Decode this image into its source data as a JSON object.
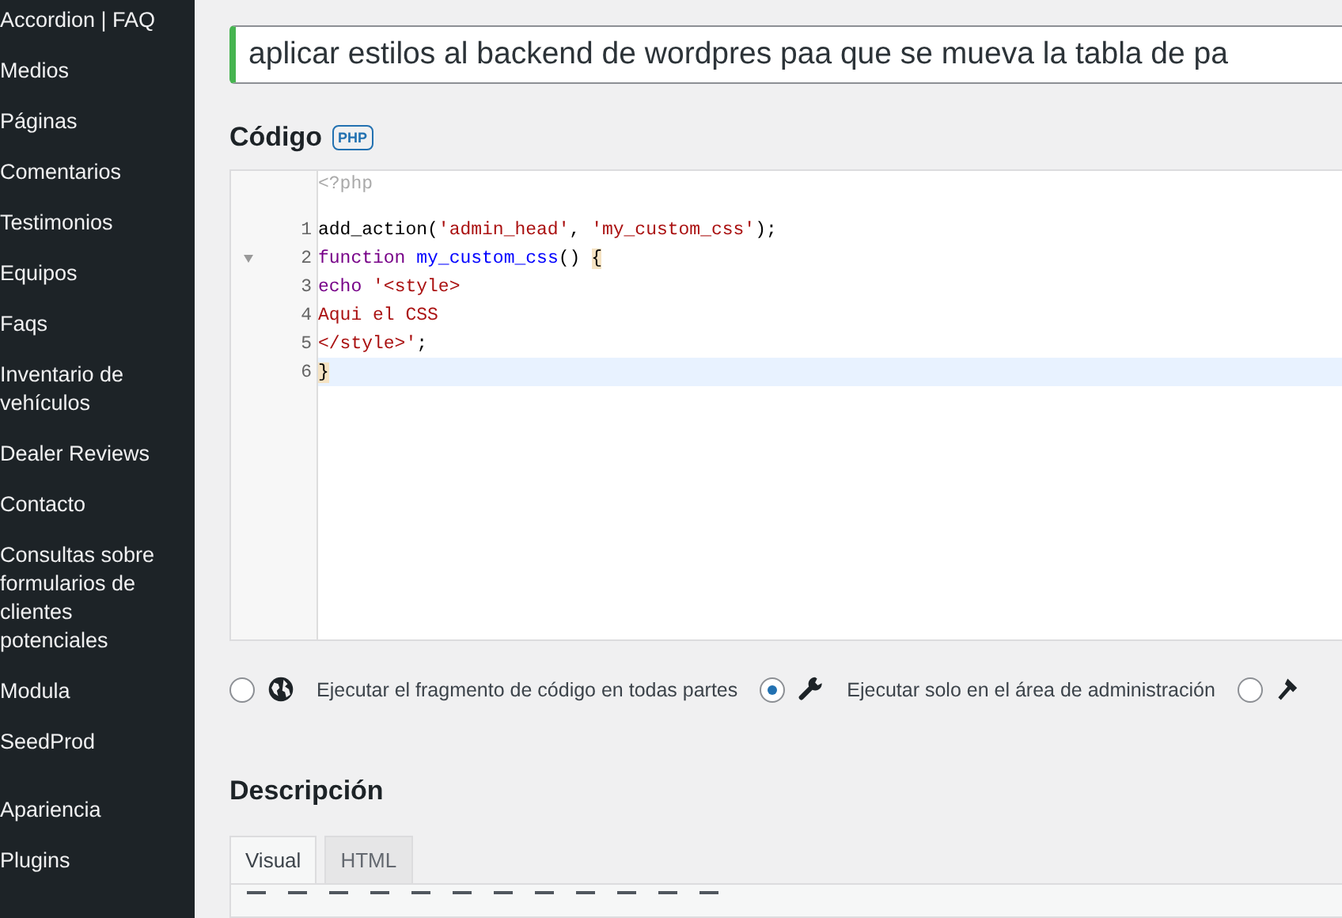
{
  "sidebar": {
    "groups": [
      {
        "items": [
          "Accordion | FAQ",
          "Medios",
          "Páginas",
          "Comentarios",
          "Testimonios",
          "Equipos",
          "Faqs",
          "Inventario de vehículos",
          "Dealer Reviews",
          "Contacto",
          "Consultas sobre formularios de clientes potenciales",
          "Modula",
          "SeedProd"
        ]
      },
      {
        "items": [
          "Apariencia",
          "Plugins"
        ]
      }
    ]
  },
  "title_field": {
    "value": "aplicar estilos al backend de wordpres paa que se mueva la tabla de pa"
  },
  "code_section": {
    "heading": "Código",
    "badge": "PHP",
    "opening_tag": "<?php",
    "lines": [
      {
        "number": "1",
        "fold": false,
        "active": false,
        "tokens": [
          {
            "kind": "plain",
            "text": "add_action("
          },
          {
            "kind": "string",
            "text": "'admin_head'"
          },
          {
            "kind": "plain",
            "text": ", "
          },
          {
            "kind": "string",
            "text": "'my_custom_css'"
          },
          {
            "kind": "plain",
            "text": ");"
          }
        ]
      },
      {
        "number": "2",
        "fold": true,
        "active": false,
        "tokens": [
          {
            "kind": "keyword",
            "text": "function "
          },
          {
            "kind": "def",
            "text": "my_custom_css"
          },
          {
            "kind": "plain",
            "text": "() "
          },
          {
            "kind": "bracket",
            "text": "{"
          }
        ]
      },
      {
        "number": "3",
        "fold": false,
        "active": false,
        "tokens": [
          {
            "kind": "keyword",
            "text": "echo "
          },
          {
            "kind": "string",
            "text": "'<style>"
          }
        ]
      },
      {
        "number": "4",
        "fold": false,
        "active": false,
        "tokens": [
          {
            "kind": "string",
            "text": "Aqui el CSS"
          }
        ]
      },
      {
        "number": "5",
        "fold": false,
        "active": false,
        "tokens": [
          {
            "kind": "string",
            "text": "</style>'"
          },
          {
            "kind": "plain",
            "text": ";"
          }
        ]
      },
      {
        "number": "6",
        "fold": false,
        "active": true,
        "tokens": [
          {
            "kind": "bracket",
            "text": "}"
          }
        ]
      }
    ]
  },
  "scope_options": [
    {
      "label": "Ejecutar el fragmento de código en todas partes",
      "selected": false
    },
    {
      "label": "Ejecutar solo en el área de administración",
      "selected": true
    },
    {
      "selected": false
    }
  ],
  "description_section": {
    "heading": "Descripción",
    "tabs": [
      {
        "label": "Visual",
        "selected": true
      },
      {
        "label": "HTML",
        "selected": false
      }
    ]
  }
}
